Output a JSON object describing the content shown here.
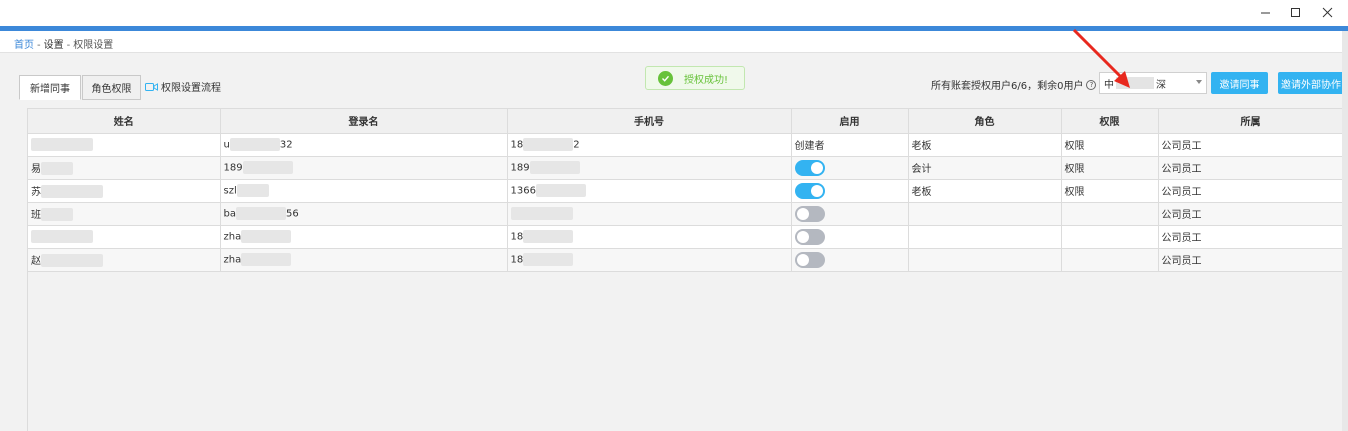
{
  "breadcrumb": {
    "home": "首页",
    "sep": "-",
    "settings": "设置",
    "current": "权限设置"
  },
  "tabs": [
    {
      "label": "新增同事",
      "active": true
    },
    {
      "label": "角色权限",
      "active": false
    }
  ],
  "flow_link": {
    "label": "权限设置流程",
    "icon": "video-icon"
  },
  "toast": {
    "text": "授权成功!",
    "icon": "check-circle-icon",
    "color": "#67c23a"
  },
  "quota": {
    "text": "所有账套授权用户6/6，剩余0用户",
    "icon": "help-icon"
  },
  "account_select": {
    "prefix": "中",
    "suffix": "深",
    "selected_visible": "中 … 深"
  },
  "buttons": {
    "invite": "邀请同事",
    "invite_external": "邀请外部协作"
  },
  "colors": {
    "accent": "#33b3f1",
    "header_bar": "#3c88d9",
    "toggle_off": "#b4b8c0"
  },
  "table": {
    "columns": [
      "姓名",
      "登录名",
      "手机号",
      "启用",
      "角色",
      "权限",
      "所属"
    ],
    "rows": [
      {
        "name": "",
        "login_prefix": "u",
        "login_suffix": "32",
        "phone_prefix": "18",
        "phone_suffix": "2",
        "enabled": "创建者",
        "role": "老板",
        "permission": "权限",
        "dept": "公司员工"
      },
      {
        "name": "易",
        "login_prefix": "189",
        "login_suffix": "",
        "phone_prefix": "189",
        "phone_suffix": "",
        "enabled": true,
        "role": "会计",
        "permission": "权限",
        "dept": "公司员工"
      },
      {
        "name": "苏",
        "login_prefix": "szl",
        "login_suffix": "",
        "phone_prefix": "1366",
        "phone_suffix": "",
        "enabled": true,
        "role": "老板",
        "permission": "权限",
        "dept": "公司员工"
      },
      {
        "name": "班",
        "login_prefix": "ba",
        "login_suffix": "56",
        "phone_prefix": "",
        "phone_suffix": "",
        "enabled": false,
        "role": "",
        "permission": "",
        "dept": "公司员工"
      },
      {
        "name": "",
        "login_prefix": "zha",
        "login_suffix": "",
        "phone_prefix": "18",
        "phone_suffix": "",
        "enabled": false,
        "role": "",
        "permission": "",
        "dept": "公司员工"
      },
      {
        "name": "赵",
        "login_prefix": "zha",
        "login_suffix": "",
        "phone_prefix": "18",
        "phone_suffix": "",
        "enabled": false,
        "role": "",
        "permission": "",
        "dept": "公司员工"
      }
    ]
  }
}
